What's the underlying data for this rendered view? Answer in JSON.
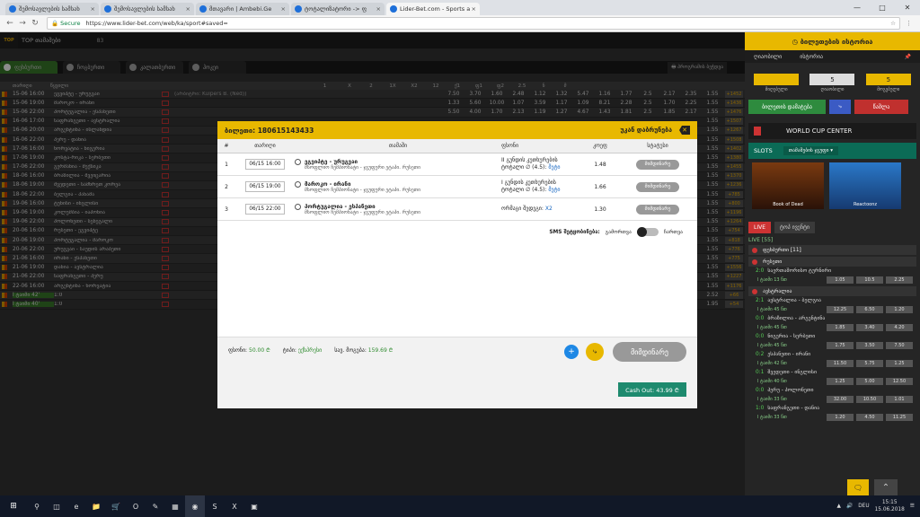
{
  "browser": {
    "tabs": [
      {
        "label": "შემოსავლების სამსახ"
      },
      {
        "label": "შემოსავლების სამსახ"
      },
      {
        "label": "მთავარი | Ambebi.Ge"
      },
      {
        "label": "ტოტალიზატორი -> ფ"
      },
      {
        "label": "Lider-Bet.com - Sports a"
      }
    ],
    "secure_label": "Secure",
    "url": "https://www.lider-bet.com/web/ka/sport#saved="
  },
  "site": {
    "top_label": "TOP თამაშები",
    "top_count": "83",
    "sport_tabs": [
      {
        "label": "ფეხბურთი"
      },
      {
        "label": "ჩოგბურთი"
      },
      {
        "label": "კალათბურთი"
      },
      {
        "label": "ჰოკეი"
      }
    ],
    "filter_label": "პროგრამის ბეჭდვა",
    "columns": [
      "თარიღი",
      "წყვილი",
      "1",
      "X",
      "2",
      "1X",
      "X2",
      "12",
      "ქ1",
      "ფ1",
      "ფ2",
      "2.5",
      "ნ",
      "მ",
      ""
    ],
    "rows": [
      {
        "dt": "15-06 16:00",
        "match": "ეგვიპტე - ურუგვაი",
        "ref": "(არბიტრი: Kuipers B. (Ned))",
        "odds": [
          "7.50",
          "3.70",
          "1.60",
          "2.48",
          "1.12",
          "1.32",
          "5.47",
          "1.16",
          "1.77",
          "2.5",
          "2.17",
          "2.35"
        ],
        "extra": "1.55",
        "plus": "+1452",
        "live": false
      },
      {
        "dt": "15-06 19:00",
        "match": "მაროკო - ირანი",
        "ref": "",
        "odds": [
          "1.33",
          "5.60",
          "10.00",
          "1.07",
          "3.59",
          "1.17",
          "1.09",
          "8.21",
          "2.28",
          "2.5",
          "1.70",
          "2.25"
        ],
        "extra": "1.55",
        "plus": "+1436",
        "live": false
      },
      {
        "dt": "15-06 22:00",
        "match": "პორტუგალია - ესპანეთი",
        "ref": "",
        "odds": [
          "5.50",
          "4.00",
          "1.70",
          "2.13",
          "1.19",
          "1.27",
          "4.67",
          "1.43",
          "1.81",
          "2.5",
          "1.85",
          "2.17"
        ],
        "extra": "1.55",
        "plus": "+1476",
        "live": false
      },
      {
        "dt": "16-06 17:00",
        "match": "საფრანგეთი - ავსტრალია",
        "ref": "",
        "odds": [
          "",
          "",
          "",
          "",
          "",
          "",
          "",
          "",
          "",
          "",
          "",
          ""
        ],
        "extra": "1.55",
        "plus": "+1507",
        "live": false
      },
      {
        "dt": "16-06 20:00",
        "match": "არგენტინა - ისლანდია",
        "ref": "",
        "odds": [
          "",
          "",
          "",
          "",
          "",
          "",
          "",
          "",
          "",
          "",
          "",
          ""
        ],
        "extra": "1.55",
        "plus": "+1267",
        "live": false
      },
      {
        "dt": "16-06 22:00",
        "match": "პერუ - დანია",
        "ref": "",
        "odds": [
          "",
          "",
          "",
          "",
          "",
          "",
          "",
          "",
          "",
          "",
          "",
          ""
        ],
        "extra": "1.55",
        "plus": "+1508",
        "live": false
      },
      {
        "dt": "17-06 16:00",
        "match": "ხორვატია - ნიგერია",
        "ref": "",
        "odds": [
          "",
          "",
          "",
          "",
          "",
          "",
          "",
          "",
          "",
          "",
          "",
          ""
        ],
        "extra": "1.55",
        "plus": "+1402",
        "live": false
      },
      {
        "dt": "17-06 19:00",
        "match": "კოსტა-რიკა - სერბეთი",
        "ref": "",
        "odds": [
          "",
          "",
          "",
          "",
          "",
          "",
          "",
          "",
          "",
          "",
          "",
          ""
        ],
        "extra": "1.55",
        "plus": "+1380",
        "live": false
      },
      {
        "dt": "17-06 22:00",
        "match": "გერმანია - მექსიკა",
        "ref": "",
        "odds": [
          "",
          "",
          "",
          "",
          "",
          "",
          "",
          "",
          "",
          "",
          "",
          ""
        ],
        "extra": "1.55",
        "plus": "+1455",
        "live": false
      },
      {
        "dt": "18-06 16:00",
        "match": "ბრაზილია - შვეიცარია",
        "ref": "",
        "odds": [
          "",
          "",
          "",
          "",
          "",
          "",
          "",
          "",
          "",
          "",
          "",
          ""
        ],
        "extra": "1.55",
        "plus": "+1370",
        "live": false
      },
      {
        "dt": "18-06 19:00",
        "match": "შვედეთი - სამხრეთ კორეა",
        "ref": "",
        "odds": [
          "",
          "",
          "",
          "",
          "",
          "",
          "",
          "",
          "",
          "",
          "",
          ""
        ],
        "extra": "1.55",
        "plus": "+1236",
        "live": false
      },
      {
        "dt": "18-06 22:00",
        "match": "ბელგია - პანამა",
        "ref": "",
        "odds": [
          "",
          "",
          "",
          "",
          "",
          "",
          "",
          "",
          "",
          "",
          "",
          ""
        ],
        "extra": "1.55",
        "plus": "+785",
        "live": false
      },
      {
        "dt": "19-06 16:00",
        "match": "ტუნისი - ინგლისი",
        "ref": "",
        "odds": [
          "",
          "",
          "",
          "",
          "",
          "",
          "",
          "",
          "",
          "",
          "",
          ""
        ],
        "extra": "1.55",
        "plus": "+800",
        "live": false
      },
      {
        "dt": "19-06 19:00",
        "match": "კოლუმბია - იაპონია",
        "ref": "",
        "odds": [
          "",
          "",
          "",
          "",
          "",
          "",
          "",
          "",
          "",
          "",
          "",
          ""
        ],
        "extra": "1.55",
        "plus": "+1196",
        "live": false
      },
      {
        "dt": "19-06 22:00",
        "match": "პოლონეთი - სენეგალი",
        "ref": "",
        "odds": [
          "",
          "",
          "",
          "",
          "",
          "",
          "",
          "",
          "",
          "",
          "",
          ""
        ],
        "extra": "1.55",
        "plus": "+1264",
        "live": false
      },
      {
        "dt": "20-06 16:00",
        "match": "რუსეთი - ეგვიპტე",
        "ref": "",
        "odds": [
          "",
          "",
          "",
          "",
          "",
          "",
          "",
          "",
          "",
          "",
          "",
          ""
        ],
        "extra": "1.55",
        "plus": "+754",
        "live": false
      },
      {
        "dt": "20-06 19:00",
        "match": "პორტუგალია - მაროკო",
        "ref": "",
        "odds": [
          "",
          "",
          "",
          "",
          "",
          "",
          "",
          "",
          "",
          "",
          "",
          ""
        ],
        "extra": "1.55",
        "plus": "+818",
        "live": false
      },
      {
        "dt": "20-06 22:00",
        "match": "ურუგვაი - საუდის არაბეთი",
        "ref": "",
        "odds": [
          "",
          "",
          "",
          "",
          "",
          "",
          "",
          "",
          "",
          "",
          "",
          ""
        ],
        "extra": "1.55",
        "plus": "+776",
        "live": false
      },
      {
        "dt": "21-06 16:00",
        "match": "ირანი - ესპანეთი",
        "ref": "",
        "odds": [
          "",
          "",
          "",
          "",
          "",
          "",
          "",
          "",
          "",
          "",
          "",
          ""
        ],
        "extra": "1.55",
        "plus": "+775",
        "live": false
      },
      {
        "dt": "21-06 19:00",
        "match": "დანია - ავსტრალია",
        "ref": "",
        "odds": [
          "",
          "",
          "",
          "",
          "",
          "",
          "",
          "",
          "",
          "",
          "",
          ""
        ],
        "extra": "1.55",
        "plus": "+1556",
        "live": false
      },
      {
        "dt": "21-06 22:00",
        "match": "საფრანგეთი - პერუ",
        "ref": "",
        "odds": [
          "",
          "",
          "",
          "",
          "",
          "",
          "",
          "",
          "",
          "",
          "",
          ""
        ],
        "extra": "1.55",
        "plus": "+1227",
        "live": false
      },
      {
        "dt": "22-06 16:00",
        "match": "არგენტინა - ხორვატია",
        "ref": "",
        "odds": [
          "",
          "",
          "",
          "",
          "",
          "",
          "",
          "",
          "",
          "",
          "",
          ""
        ],
        "extra": "1.55",
        "plus": "+1176",
        "live": false
      },
      {
        "dt": "I ტაიმი 42'",
        "match": "1:0",
        "ref": "",
        "odds": [
          "",
          "",
          "",
          "",
          "",
          "",
          "",
          "",
          "",
          "",
          "",
          ""
        ],
        "extra": "2.52",
        "plus": "+66",
        "live": true
      },
      {
        "dt": "I ტაიმი 40'",
        "match": "1:0",
        "ref": "",
        "odds": [
          "",
          "",
          "",
          "",
          "",
          "",
          "",
          "",
          "",
          "",
          "",
          ""
        ],
        "extra": "1.95",
        "plus": "+54",
        "live": true
      }
    ]
  },
  "rpanel": {
    "title": "ბილეთების ისტორია",
    "tabs": [
      "ღიაობილი",
      "ისტორია"
    ],
    "stats": [
      {
        "label": "მიღებული",
        "value": ""
      },
      {
        "label": "ღიაობილი",
        "value": "5"
      },
      {
        "label": "მოგებული",
        "value": "5"
      }
    ],
    "btn_blue": "ბილეთის დამატება",
    "btn_red": "წაშლა",
    "world_cup": "WORLD CUP CENTER",
    "slots_label": "SLOTS",
    "slots_select": "თამაშების ჯგუფი",
    "games": [
      {
        "name": "Book of Dead"
      },
      {
        "name": "Reactoonz"
      }
    ],
    "live_tabs": [
      "LIVE",
      "ტოპ ივენტი"
    ],
    "live_count": "LIVE [55]",
    "sections": [
      {
        "name": "ფეხბურთი [11]",
        "matches": []
      },
      {
        "name": "რუსეთი",
        "matches": [
          {
            "score": "2:0",
            "name": "საერთაშორისო ტურნირი",
            "info": "I ტაიმი 13 წთ",
            "odds": [
              "1.05",
              "10.5",
              "2.25"
            ]
          }
        ]
      },
      {
        "name": "ავსტრალია",
        "matches": [
          {
            "score": "2:1",
            "name": "ავსტრალია - ბელგია",
            "info": "I ტაიმი 45 წთ",
            "odds": [
              "12.25",
              "6.50",
              "1.20"
            ]
          },
          {
            "score": "0:0",
            "name": "ბრაზილია - არგენტინა",
            "info": "I ტაიმი 45 წთ",
            "odds": [
              "1.85",
              "3.40",
              "4.20"
            ]
          },
          {
            "score": "0:0",
            "name": "ნიგერია - სერბეთი",
            "info": "I ტაიმი 45 წთ",
            "odds": [
              "1.75",
              "3.50",
              "7.50"
            ]
          },
          {
            "score": "0:2",
            "name": "ესპანეთი - ირანი",
            "info": "I ტაიმი 42 წთ",
            "odds": [
              "11.50",
              "5.75",
              "1.25"
            ]
          },
          {
            "score": "0:1",
            "name": "შვედეთი - ინგლისი",
            "info": "I ტაიმი 40 წთ",
            "odds": [
              "1.25",
              "5.00",
              "12.50"
            ]
          },
          {
            "score": "0:0",
            "name": "პერუ - პოლონეთი",
            "info": "I ტაიმი 33 წთ",
            "odds": [
              "32.00",
              "10.50",
              "1.01"
            ]
          },
          {
            "score": "1:0",
            "name": "საფრანგეთი - დანია",
            "info": "I ტაიმი 33 წთ",
            "odds": [
              "1.20",
              "4.50",
              "11.25"
            ]
          }
        ]
      }
    ]
  },
  "modal": {
    "ticket_label": "ბილეთი: 180615143433",
    "back_label": "უკან დაბრუნება",
    "columns": [
      "#",
      "თარიღი",
      "თამაში",
      "ფსონი",
      "კოეფ",
      "სტატუსი"
    ],
    "rows": [
      {
        "n": "1",
        "date": "06/15 16:00",
        "teams": "ეგვიპტე - ურუგვაი",
        "league": "მსოფლიო ჩემპიონატი - ჯგუფური ეტაპი. რუსეთი",
        "bet_l1": "II გუნდის კუთხურების",
        "bet_l2": "ტოტალი ∅ (4.5):",
        "bet_pick": "მეტი",
        "coef": "1.48",
        "status": "მიმდინარე"
      },
      {
        "n": "2",
        "date": "06/15 19:00",
        "teams": "მაროკო - ირანი",
        "league": "მსოფლიო ჩემპიონატი - ჯგუფური ეტაპი. რუსეთი",
        "bet_l1": "I გუნდის კუთხურების",
        "bet_l2": "ტოტალი ∅ (4.5):",
        "bet_pick": "მეტი",
        "coef": "1.66",
        "status": "მიმდინარე"
      },
      {
        "n": "3",
        "date": "06/15 22:00",
        "teams": "პორტუგალია - ესპანეთი",
        "league": "მსოფლიო ჩემპიონატი - ჯგუფური ეტაპი. რუსეთი",
        "bet_l1": "ორმაგი შედეგი:",
        "bet_l2": "",
        "bet_pick": "X2",
        "coef": "1.30",
        "status": "მიმდინარე"
      }
    ],
    "sms_label": "SMS შეტყობინება:",
    "sms_off": "გამორთვა",
    "sms_on": "ჩართვა",
    "stake_label": "ფსონი:",
    "stake_value": "50.00 ₾",
    "type_label": "ტიპი:",
    "type_value": "ექსპრესი",
    "win_label": "სავ. მოგება:",
    "win_value": "159.69 ₾",
    "status_button": "მიმდინარე",
    "cashout": "Cash Out: 43.99 ₾"
  },
  "taskbar": {
    "lang": "DEU",
    "time": "15:15",
    "date": "15.06.2018"
  }
}
